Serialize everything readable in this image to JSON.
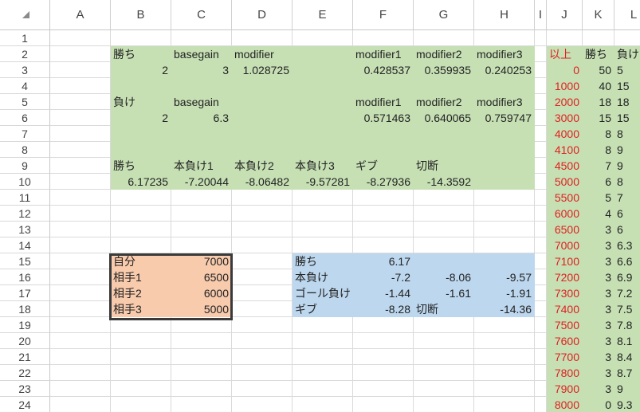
{
  "colors": {
    "green": "#c6e0b4",
    "blue": "#bdd7ee",
    "orange": "#f8cbad",
    "red_text": "#e02020"
  },
  "columns": [
    "A",
    "B",
    "C",
    "D",
    "E",
    "F",
    "G",
    "H",
    "I",
    "J",
    "K",
    "L"
  ],
  "rows": [
    "1",
    "2",
    "3",
    "4",
    "5",
    "6",
    "7",
    "8",
    "9",
    "10",
    "11",
    "12",
    "13",
    "14",
    "15",
    "16",
    "17",
    "18",
    "19",
    "20",
    "21",
    "22",
    "23",
    "24"
  ],
  "cells": {
    "B2": "勝ち",
    "C2": "basegain",
    "D2": "modifier",
    "F2": "modifier1",
    "G2": "modifier2",
    "H2": "modifier3",
    "B3": "2",
    "C3": "3",
    "D3": "1.028725",
    "F3": "0.428537",
    "G3": "0.359935",
    "H3": "0.240253",
    "B5": "負け",
    "C5": "basegain",
    "F5": "modifier1",
    "G5": "modifier2",
    "H5": "modifier3",
    "B6": "2",
    "C6": "6.3",
    "F6": "0.571463",
    "G6": "0.640065",
    "H6": "0.759747",
    "B9": "勝ち",
    "C9": "本負け1",
    "D9": "本負け2",
    "E9": "本負け3",
    "F9": "ギブ",
    "G9": "切断",
    "B10": "6.17235",
    "C10": "-7.20044",
    "D10": "-8.06482",
    "E10": "-9.57281",
    "F10": "-8.27936",
    "G10": "-14.3592",
    "B15": "自分",
    "C15": "7000",
    "B16": "相手1",
    "C16": "6500",
    "B17": "相手2",
    "C17": "6000",
    "B18": "相手3",
    "C18": "5000",
    "E15": "勝ち",
    "F15": "6.17",
    "E16": "本負け",
    "F16": "-7.2",
    "G16": "-8.06",
    "H16": "-9.57",
    "E17": "ゴール負け",
    "F17": "-1.44",
    "G17": "-1.61",
    "H17": "-1.91",
    "E18": "ギブ",
    "F18": "-8.28",
    "G18": "切断",
    "H18": "-14.36"
  },
  "lookup_table": {
    "headers": [
      "以上",
      "勝ち",
      "負け"
    ],
    "rows": [
      [
        "0",
        "50",
        "5"
      ],
      [
        "1000",
        "40",
        "15"
      ],
      [
        "2000",
        "18",
        "18"
      ],
      [
        "3000",
        "15",
        "15"
      ],
      [
        "4000",
        "8",
        "8"
      ],
      [
        "4100",
        "8",
        "9"
      ],
      [
        "4500",
        "7",
        "9"
      ],
      [
        "5000",
        "6",
        "8"
      ],
      [
        "5500",
        "5",
        "7"
      ],
      [
        "6000",
        "4",
        "6"
      ],
      [
        "6500",
        "3",
        "6"
      ],
      [
        "7000",
        "3",
        "6.3"
      ],
      [
        "7100",
        "3",
        "6.6"
      ],
      [
        "7200",
        "3",
        "6.9"
      ],
      [
        "7300",
        "3",
        "7.2"
      ],
      [
        "7400",
        "3",
        "7.5"
      ],
      [
        "7500",
        "3",
        "7.8"
      ],
      [
        "7600",
        "3",
        "8.1"
      ],
      [
        "7700",
        "3",
        "8.4"
      ],
      [
        "7800",
        "3",
        "8.7"
      ],
      [
        "7900",
        "3",
        "9"
      ],
      [
        "8000",
        "0",
        "9.3"
      ]
    ]
  }
}
